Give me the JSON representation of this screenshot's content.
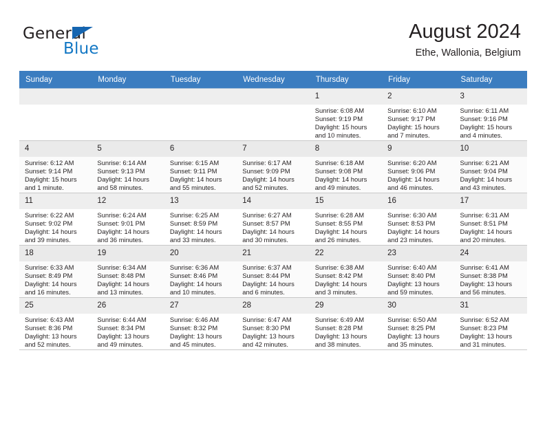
{
  "brand": {
    "word_one": "General",
    "word_two": "Blue",
    "flag_icon": "blue-triangle-flag-icon",
    "accent_color": "#1277c4"
  },
  "header": {
    "month_title": "August 2024",
    "location": "Ethe, Wallonia, Belgium",
    "header_bg_color": "#3b7dc0"
  },
  "calendar": {
    "weekday_headers": [
      "Sunday",
      "Monday",
      "Tuesday",
      "Wednesday",
      "Thursday",
      "Friday",
      "Saturday"
    ],
    "weeks": [
      [
        {
          "day": "",
          "sunrise": "",
          "sunset": "",
          "daylight": ""
        },
        {
          "day": "",
          "sunrise": "",
          "sunset": "",
          "daylight": ""
        },
        {
          "day": "",
          "sunrise": "",
          "sunset": "",
          "daylight": ""
        },
        {
          "day": "",
          "sunrise": "",
          "sunset": "",
          "daylight": ""
        },
        {
          "day": "1",
          "sunrise": "Sunrise: 6:08 AM",
          "sunset": "Sunset: 9:19 PM",
          "daylight": "Daylight: 15 hours and 10 minutes."
        },
        {
          "day": "2",
          "sunrise": "Sunrise: 6:10 AM",
          "sunset": "Sunset: 9:17 PM",
          "daylight": "Daylight: 15 hours and 7 minutes."
        },
        {
          "day": "3",
          "sunrise": "Sunrise: 6:11 AM",
          "sunset": "Sunset: 9:16 PM",
          "daylight": "Daylight: 15 hours and 4 minutes."
        }
      ],
      [
        {
          "day": "4",
          "sunrise": "Sunrise: 6:12 AM",
          "sunset": "Sunset: 9:14 PM",
          "daylight": "Daylight: 15 hours and 1 minute."
        },
        {
          "day": "5",
          "sunrise": "Sunrise: 6:14 AM",
          "sunset": "Sunset: 9:13 PM",
          "daylight": "Daylight: 14 hours and 58 minutes."
        },
        {
          "day": "6",
          "sunrise": "Sunrise: 6:15 AM",
          "sunset": "Sunset: 9:11 PM",
          "daylight": "Daylight: 14 hours and 55 minutes."
        },
        {
          "day": "7",
          "sunrise": "Sunrise: 6:17 AM",
          "sunset": "Sunset: 9:09 PM",
          "daylight": "Daylight: 14 hours and 52 minutes."
        },
        {
          "day": "8",
          "sunrise": "Sunrise: 6:18 AM",
          "sunset": "Sunset: 9:08 PM",
          "daylight": "Daylight: 14 hours and 49 minutes."
        },
        {
          "day": "9",
          "sunrise": "Sunrise: 6:20 AM",
          "sunset": "Sunset: 9:06 PM",
          "daylight": "Daylight: 14 hours and 46 minutes."
        },
        {
          "day": "10",
          "sunrise": "Sunrise: 6:21 AM",
          "sunset": "Sunset: 9:04 PM",
          "daylight": "Daylight: 14 hours and 43 minutes."
        }
      ],
      [
        {
          "day": "11",
          "sunrise": "Sunrise: 6:22 AM",
          "sunset": "Sunset: 9:02 PM",
          "daylight": "Daylight: 14 hours and 39 minutes."
        },
        {
          "day": "12",
          "sunrise": "Sunrise: 6:24 AM",
          "sunset": "Sunset: 9:01 PM",
          "daylight": "Daylight: 14 hours and 36 minutes."
        },
        {
          "day": "13",
          "sunrise": "Sunrise: 6:25 AM",
          "sunset": "Sunset: 8:59 PM",
          "daylight": "Daylight: 14 hours and 33 minutes."
        },
        {
          "day": "14",
          "sunrise": "Sunrise: 6:27 AM",
          "sunset": "Sunset: 8:57 PM",
          "daylight": "Daylight: 14 hours and 30 minutes."
        },
        {
          "day": "15",
          "sunrise": "Sunrise: 6:28 AM",
          "sunset": "Sunset: 8:55 PM",
          "daylight": "Daylight: 14 hours and 26 minutes."
        },
        {
          "day": "16",
          "sunrise": "Sunrise: 6:30 AM",
          "sunset": "Sunset: 8:53 PM",
          "daylight": "Daylight: 14 hours and 23 minutes."
        },
        {
          "day": "17",
          "sunrise": "Sunrise: 6:31 AM",
          "sunset": "Sunset: 8:51 PM",
          "daylight": "Daylight: 14 hours and 20 minutes."
        }
      ],
      [
        {
          "day": "18",
          "sunrise": "Sunrise: 6:33 AM",
          "sunset": "Sunset: 8:49 PM",
          "daylight": "Daylight: 14 hours and 16 minutes."
        },
        {
          "day": "19",
          "sunrise": "Sunrise: 6:34 AM",
          "sunset": "Sunset: 8:48 PM",
          "daylight": "Daylight: 14 hours and 13 minutes."
        },
        {
          "day": "20",
          "sunrise": "Sunrise: 6:36 AM",
          "sunset": "Sunset: 8:46 PM",
          "daylight": "Daylight: 14 hours and 10 minutes."
        },
        {
          "day": "21",
          "sunrise": "Sunrise: 6:37 AM",
          "sunset": "Sunset: 8:44 PM",
          "daylight": "Daylight: 14 hours and 6 minutes."
        },
        {
          "day": "22",
          "sunrise": "Sunrise: 6:38 AM",
          "sunset": "Sunset: 8:42 PM",
          "daylight": "Daylight: 14 hours and 3 minutes."
        },
        {
          "day": "23",
          "sunrise": "Sunrise: 6:40 AM",
          "sunset": "Sunset: 8:40 PM",
          "daylight": "Daylight: 13 hours and 59 minutes."
        },
        {
          "day": "24",
          "sunrise": "Sunrise: 6:41 AM",
          "sunset": "Sunset: 8:38 PM",
          "daylight": "Daylight: 13 hours and 56 minutes."
        }
      ],
      [
        {
          "day": "25",
          "sunrise": "Sunrise: 6:43 AM",
          "sunset": "Sunset: 8:36 PM",
          "daylight": "Daylight: 13 hours and 52 minutes."
        },
        {
          "day": "26",
          "sunrise": "Sunrise: 6:44 AM",
          "sunset": "Sunset: 8:34 PM",
          "daylight": "Daylight: 13 hours and 49 minutes."
        },
        {
          "day": "27",
          "sunrise": "Sunrise: 6:46 AM",
          "sunset": "Sunset: 8:32 PM",
          "daylight": "Daylight: 13 hours and 45 minutes."
        },
        {
          "day": "28",
          "sunrise": "Sunrise: 6:47 AM",
          "sunset": "Sunset: 8:30 PM",
          "daylight": "Daylight: 13 hours and 42 minutes."
        },
        {
          "day": "29",
          "sunrise": "Sunrise: 6:49 AM",
          "sunset": "Sunset: 8:28 PM",
          "daylight": "Daylight: 13 hours and 38 minutes."
        },
        {
          "day": "30",
          "sunrise": "Sunrise: 6:50 AM",
          "sunset": "Sunset: 8:25 PM",
          "daylight": "Daylight: 13 hours and 35 minutes."
        },
        {
          "day": "31",
          "sunrise": "Sunrise: 6:52 AM",
          "sunset": "Sunset: 8:23 PM",
          "daylight": "Daylight: 13 hours and 31 minutes."
        }
      ]
    ]
  }
}
